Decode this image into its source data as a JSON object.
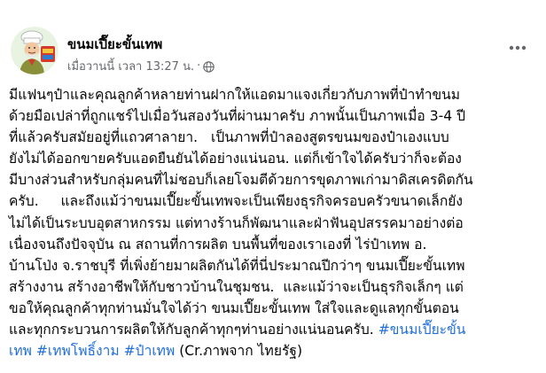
{
  "post": {
    "author": "ขนมเปี๊ยะขั้นเทพ",
    "timestamp": "เมื่อวานนี้ เวลา 13:27 น.",
    "separator": "·",
    "privacy_icon": "globe-icon",
    "more_icon": "more-options-icon",
    "body_lines": [
      "มีแฟนๆป๋าและคุณลูกค้าหลายท่านฝากให้แอดมาแจงเกี่ยวกับภาพที่ป๋าทำขนม",
      "ด้วยมือเปล่าที่ถูกแชร์ไปเมื่อวันสองวันที่ผ่านมาครับ ภาพนั้นเป็นภาพเมื่อ 3-4 ปี",
      "ที่แล้วครับสมัยอยู่ที่แถวศาลายา.   เป็นภาพที่ป๋าลองสูตรขนมของป๋าเองแบบ",
      "ยังไม่ได้ออกขายครับแอดยืนยันได้อย่างแน่นอน. แต่ก็เข้าใจได้ครับว่าก็จะต้อง",
      "มีบางส่วนสำหรับกลุ่มคนที่ไม่ชอบก็เลยโจมตีด้วยการขุดภาพเก่ามาดิสเครดิตกัน",
      "ครับ.     และถึงแม้ว่าขนมเปี๊ยะขั้นเทพจะเป็นเพียงธุรกิจครอบครัวขนาดเล็กยัง",
      "ไม่ได้เป็นระบบอุตสาหกรรม แต่ทางร้านก็พัฒนาและฝ่าฟันอุปสรรคมาอย่างต่อ",
      "เนื่องจนถึงปัจจุบัน ณ สถานที่การผลิต บนพื้นที่ของเราเองที่ ไร่ป๋าเทพ อ.",
      "บ้านโป่ง จ.ราชบุรี ที่เพิ่งย้ายมาผลิตกันได้ที่นี่ประมาณปีกว่าๆ ขนมเปี๊ยะขั้นเทพ",
      "สร้างงาน สร้างอาชีพให้กับชาวบ้านในชุมชน.  และแม้ว่าจะเป็นธุรกิจเล็กๆ แต่",
      "ขอให้คุณลูกค้าทุกท่านมั่นใจได้ว่า ขนมเปี๊ยะขั้นเทพ ใส่ใจและดูแลทุกขั้นตอน",
      "และทุกกระบวนการผลิตให้กับลูกค้าทุกๆท่านอย่างแน่นอนครับ. "
    ],
    "hashtag_1a": "#ขนมเปี๊ยะขั้น",
    "hashtag_1b": "เทพ",
    "hashtag_2": "#เทพโพธิ์งาม",
    "hashtag_3": "#ป๋าเทพ",
    "credit": "(Cr.ภาพจาก ไทยรัฐ)"
  },
  "colors": {
    "text": "#050505",
    "secondary": "#65676b",
    "hashtag": "#216fdb"
  }
}
